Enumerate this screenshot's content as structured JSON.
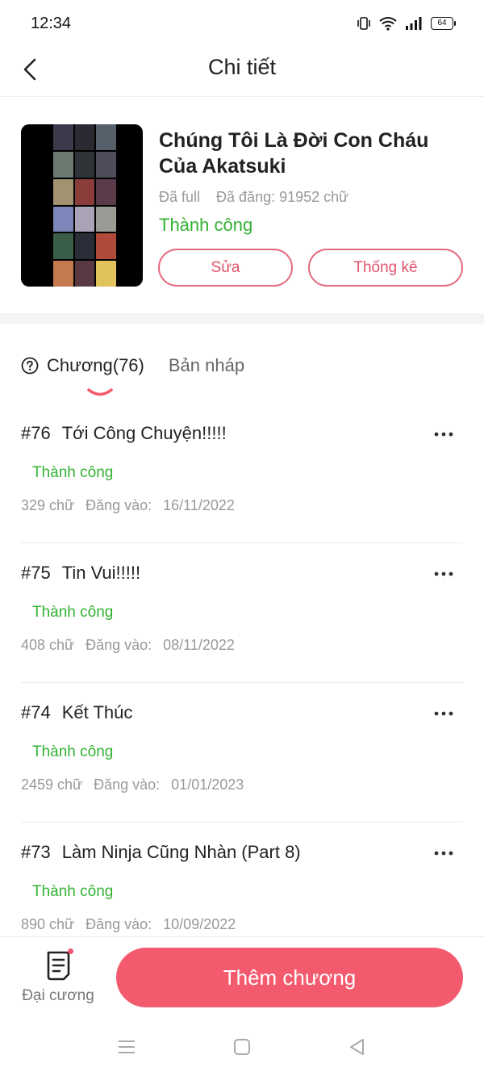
{
  "status_bar": {
    "time": "12:34",
    "battery": "64",
    "icons": [
      "vibrate-icon",
      "wifi-icon",
      "signal-icon",
      "battery-icon"
    ]
  },
  "header": {
    "title": "Chi tiết",
    "back_icon": "chevron-left-icon"
  },
  "book": {
    "title": "Chúng Tôi Là Đời Con Cháu Của Akatsuki",
    "completion": "Đã full",
    "published_words": "Đã đăng: 91952 chữ",
    "status": "Thành công",
    "edit_label": "Sửa",
    "stats_label": "Thống kê"
  },
  "tabs": {
    "chapters_label": "Chương(76)",
    "drafts_label": "Bản nháp",
    "help_icon": "question-circle-icon"
  },
  "chapters": [
    {
      "number": "#76",
      "title": "Tới Công Chuyện!!!!!",
      "status": "Thành công",
      "words": "329 chữ",
      "posted_label": "Đăng vào:",
      "date": "16/11/2022"
    },
    {
      "number": "#75",
      "title": "Tin Vui!!!!!",
      "status": "Thành công",
      "words": "408 chữ",
      "posted_label": "Đăng vào:",
      "date": "08/11/2022"
    },
    {
      "number": "#74",
      "title": "Kết Thúc",
      "status": "Thành công",
      "words": "2459 chữ",
      "posted_label": "Đăng vào:",
      "date": "01/01/2023"
    },
    {
      "number": "#73",
      "title": "Làm Ninja Cũng Nhàn (Part 8)",
      "status": "Thành công",
      "words": "890 chữ",
      "posted_label": "Đăng vào:",
      "date": "10/09/2022"
    }
  ],
  "bottom_bar": {
    "outline_label": "Đại cương",
    "add_chapter_label": "Thêm chương"
  },
  "colors": {
    "accent": "#f45a6e",
    "success": "#33b233",
    "muted": "#999999"
  }
}
